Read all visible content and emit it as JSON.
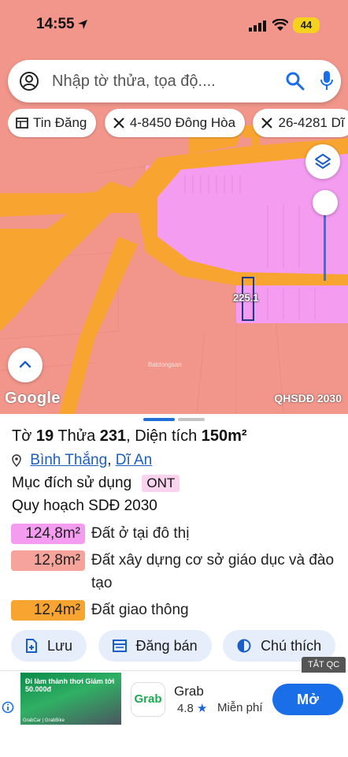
{
  "status_bar": {
    "time": "14:55",
    "battery": "44"
  },
  "search": {
    "placeholder": "Nhập tờ thửa, tọa độ...."
  },
  "chips": [
    {
      "label": "Tin Đăng",
      "icon": "table-icon"
    },
    {
      "label": "4-8450 Đông Hòa",
      "icon": "tools-icon"
    },
    {
      "label": "26-4281 Dĩ",
      "icon": "tools-icon"
    }
  ],
  "map": {
    "plot_label": "2̲2̲5.1",
    "plot_text": "225.1",
    "google": "Google",
    "layer_tag": "QHSDĐ 2030",
    "watermark": "Batdongsan"
  },
  "sheet": {
    "title_prefix": "Tờ",
    "sheet_no": "19",
    "plot_word": "Thửa",
    "plot_no": "231",
    "area_word": "Diện tích",
    "area": "150m²",
    "ward": "Bình Thắng",
    "city": "Dĩ An",
    "purpose_label": "Mục đích sử dụng",
    "purpose_code": "ONT",
    "plan_label": "Quy hoạch SDĐ 2030",
    "areas": [
      {
        "amount": "124,8m²",
        "desc": "Đất ở tại đô thị",
        "color": "#f39cf0"
      },
      {
        "amount": "12,8m²",
        "desc": "Đất xây dựng cơ sở giáo dục và đào tạo",
        "color": "#f5a39b"
      },
      {
        "amount": "12,4m²",
        "desc": "Đất giao thông",
        "color": "#f7a431"
      }
    ],
    "actions": [
      {
        "label": "Lưu",
        "icon": "save-icon"
      },
      {
        "label": "Đăng bán",
        "icon": "listing-icon"
      },
      {
        "label": "Chú thích",
        "icon": "legend-icon"
      }
    ]
  },
  "ad": {
    "close_tag": "TẮT QC",
    "app_name": "Grab",
    "app_logo_text": "Grab",
    "rating": "4.8",
    "price": "Miễn phí",
    "cta": "Mở",
    "promo_text": "Đi làm thảnh thơi Giảm tới 50.000đ",
    "promo_footer": "GrabCar | GrabBike"
  },
  "colors": {
    "map_background": "#f2968b",
    "road": "#f7a431",
    "residential": "#f39cf0",
    "accent": "#1a6fe8"
  }
}
